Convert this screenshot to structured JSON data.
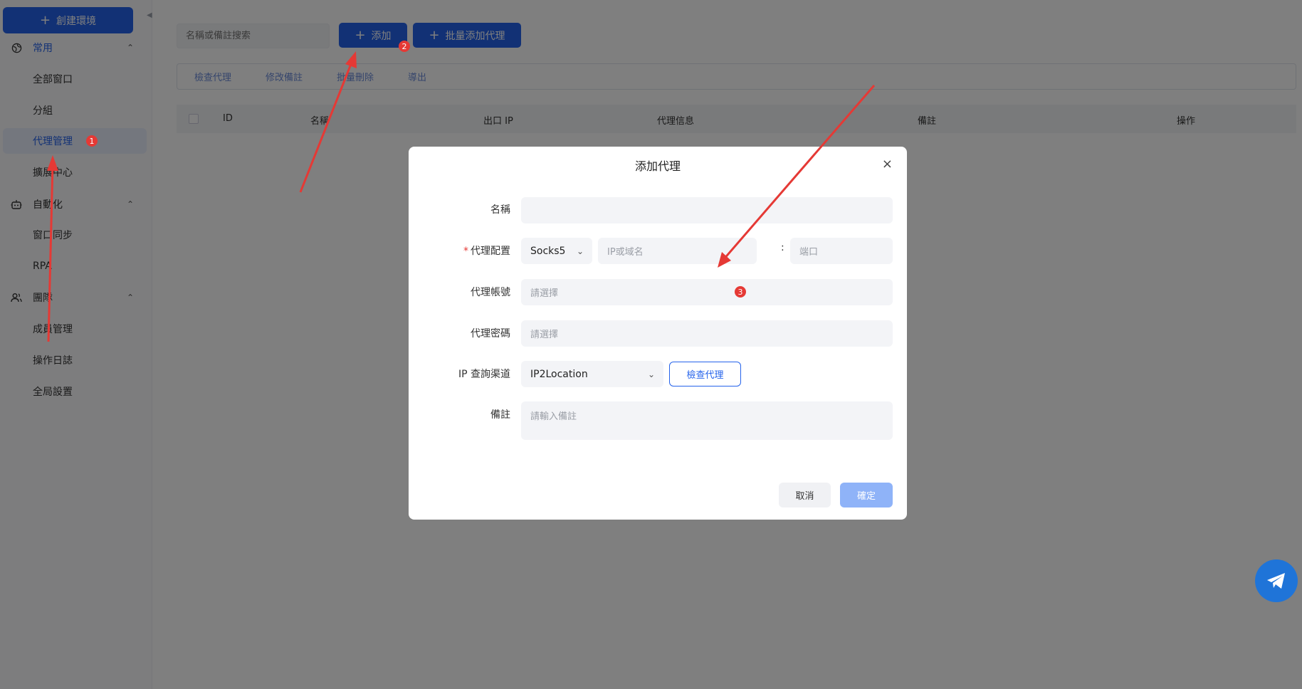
{
  "sidebar": {
    "create_label": "創建環境",
    "groups": [
      {
        "label": "常用",
        "icon": "globe-icon"
      },
      {
        "label": "自動化",
        "icon": "robot-icon"
      },
      {
        "label": "團隊",
        "icon": "users-icon"
      }
    ],
    "items": [
      {
        "label": "全部窗口"
      },
      {
        "label": "分組"
      },
      {
        "label": "代理管理"
      },
      {
        "label": "擴展中心"
      },
      {
        "label": "窗口同步"
      },
      {
        "label": "RPA"
      },
      {
        "label": "成員管理"
      },
      {
        "label": "操作日誌"
      },
      {
        "label": "全局設置"
      }
    ]
  },
  "main": {
    "search_placeholder": "名稱或備註搜索",
    "add_label": "添加",
    "batch_add_label": "批量添加代理",
    "toolbar": [
      "檢查代理",
      "修改備註",
      "批量刪除",
      "導出"
    ],
    "columns": [
      "ID",
      "名稱",
      "出口 IP",
      "代理信息",
      "備註",
      "操作"
    ]
  },
  "dialog": {
    "title": "添加代理",
    "close": "×",
    "name_label": "名稱",
    "name_value": "",
    "proxy_config_label": "代理配置",
    "required_mark": "*",
    "protocol_value": "Socks5",
    "host_placeholder": "IP或域名",
    "colon": ":",
    "port_placeholder": "端口",
    "account_label": "代理帳號",
    "account_placeholder": "請選擇",
    "password_label": "代理密碼",
    "password_placeholder": "請選擇",
    "ip_channel_label": "IP 查詢渠道",
    "ip_channel_value": "IP2Location",
    "check_label": "檢查代理",
    "remark_label": "備註",
    "remark_placeholder": "請輸入備註",
    "cancel_label": "取消",
    "ok_label": "確定"
  },
  "annotations": {
    "badge_1": "1",
    "badge_2": "2",
    "badge_3": "3",
    "arrow_color": "#e53935"
  },
  "colors": {
    "accent": "#2563eb",
    "active_bg": "#e9effc",
    "badge": "#e53935"
  }
}
